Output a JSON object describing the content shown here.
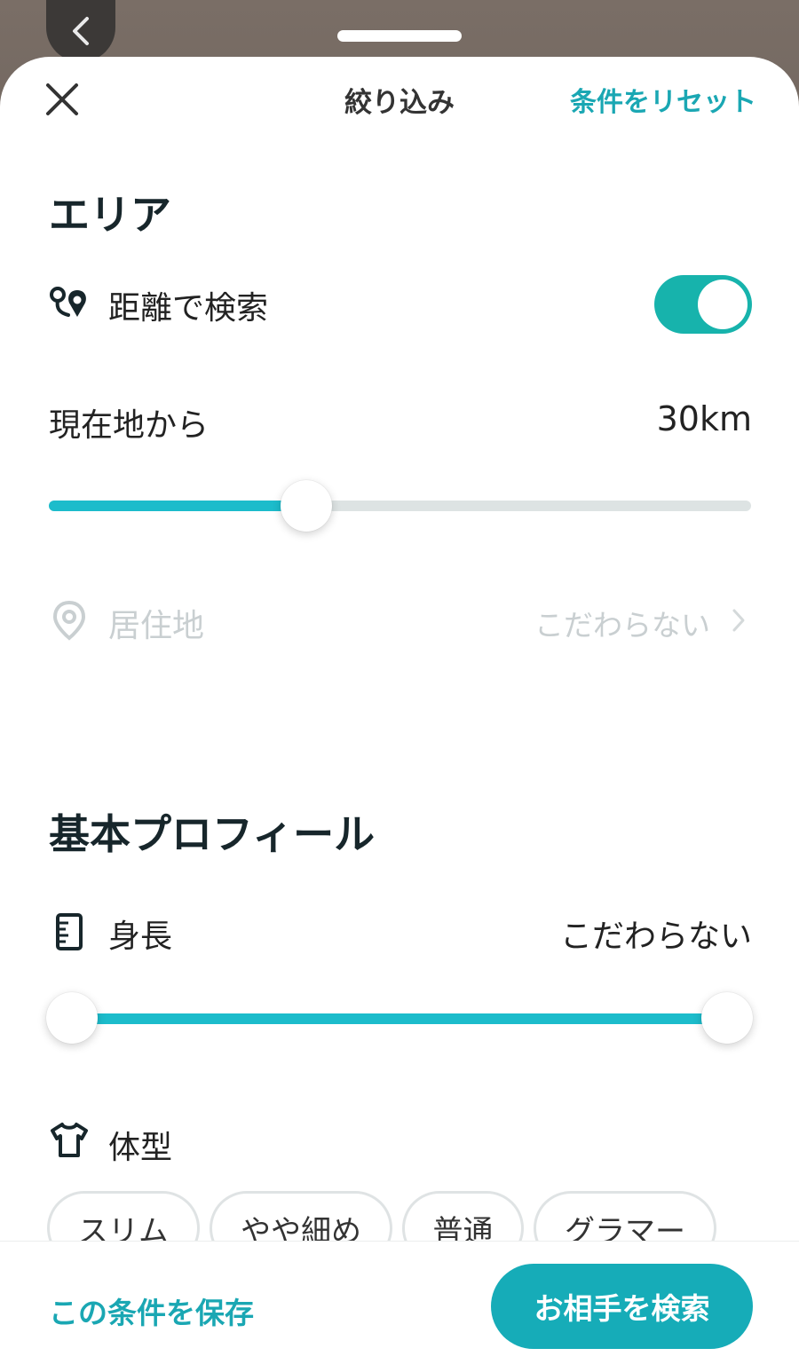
{
  "header": {
    "title": "絞り込み",
    "reset_label": "条件をリセット"
  },
  "area": {
    "section_title": "エリア",
    "distance_search": {
      "label": "距離で検索",
      "enabled": true
    },
    "from_current": {
      "label": "現在地から",
      "value": "30km",
      "slider_fraction": 0.34
    },
    "residence": {
      "label": "居住地",
      "value": "こだわらない"
    }
  },
  "basic_profile": {
    "section_title": "基本プロフィール",
    "height": {
      "label": "身長",
      "value": "こだわらない",
      "range_fraction": [
        0.0,
        1.0
      ]
    },
    "body_type": {
      "label": "体型",
      "options": [
        "スリム",
        "やや細め",
        "普通",
        "グラマー"
      ]
    }
  },
  "footer": {
    "save_label": "この条件を保存",
    "search_label": "お相手を検索"
  },
  "colors": {
    "accent": "#1aa7b3",
    "toggle_on": "#17b3ac",
    "track_active": "#1cbccb",
    "track_inactive": "#dde3e3"
  }
}
